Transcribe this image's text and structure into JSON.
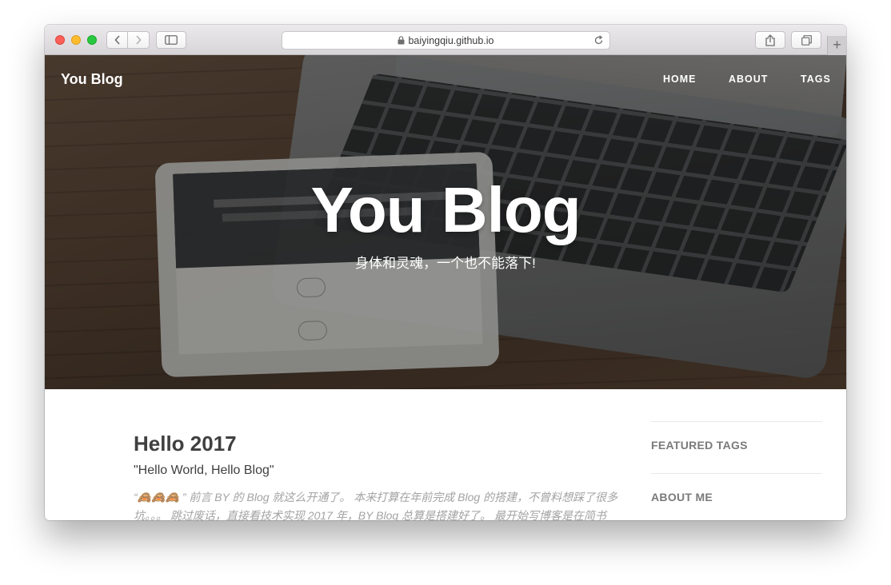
{
  "browser": {
    "url": "baiyingqiu.github.io",
    "icons": [
      "back-icon",
      "forward-icon",
      "sidebar-icon",
      "lock-icon",
      "reload-icon",
      "share-icon",
      "tabs-icon",
      "plus-icon"
    ],
    "new_tab_label": "+"
  },
  "navbar": {
    "brand": "You Blog",
    "links": [
      {
        "label": "HOME"
      },
      {
        "label": "ABOUT"
      },
      {
        "label": "TAGS"
      }
    ]
  },
  "hero": {
    "title": "You Blog",
    "subtitle": "身体和灵魂，一个也不能落下!"
  },
  "post": {
    "title": "Hello 2017",
    "subtitle": "\"Hello World, Hello Blog\"",
    "excerpt": "“🙈🙈🙈 ” 前言 BY 的 Blog 就这么开通了。 本来打算在年前完成 Blog 的搭建，不曾料想踩了很多坑。。。 跳过废话，直接看技术实现 2017 年，BY Blog 总算是搭建好了。 最开始写博客是在简书"
  },
  "sidebar": {
    "featured_tags": "FEATURED TAGS",
    "about_me": "ABOUT ME"
  }
}
